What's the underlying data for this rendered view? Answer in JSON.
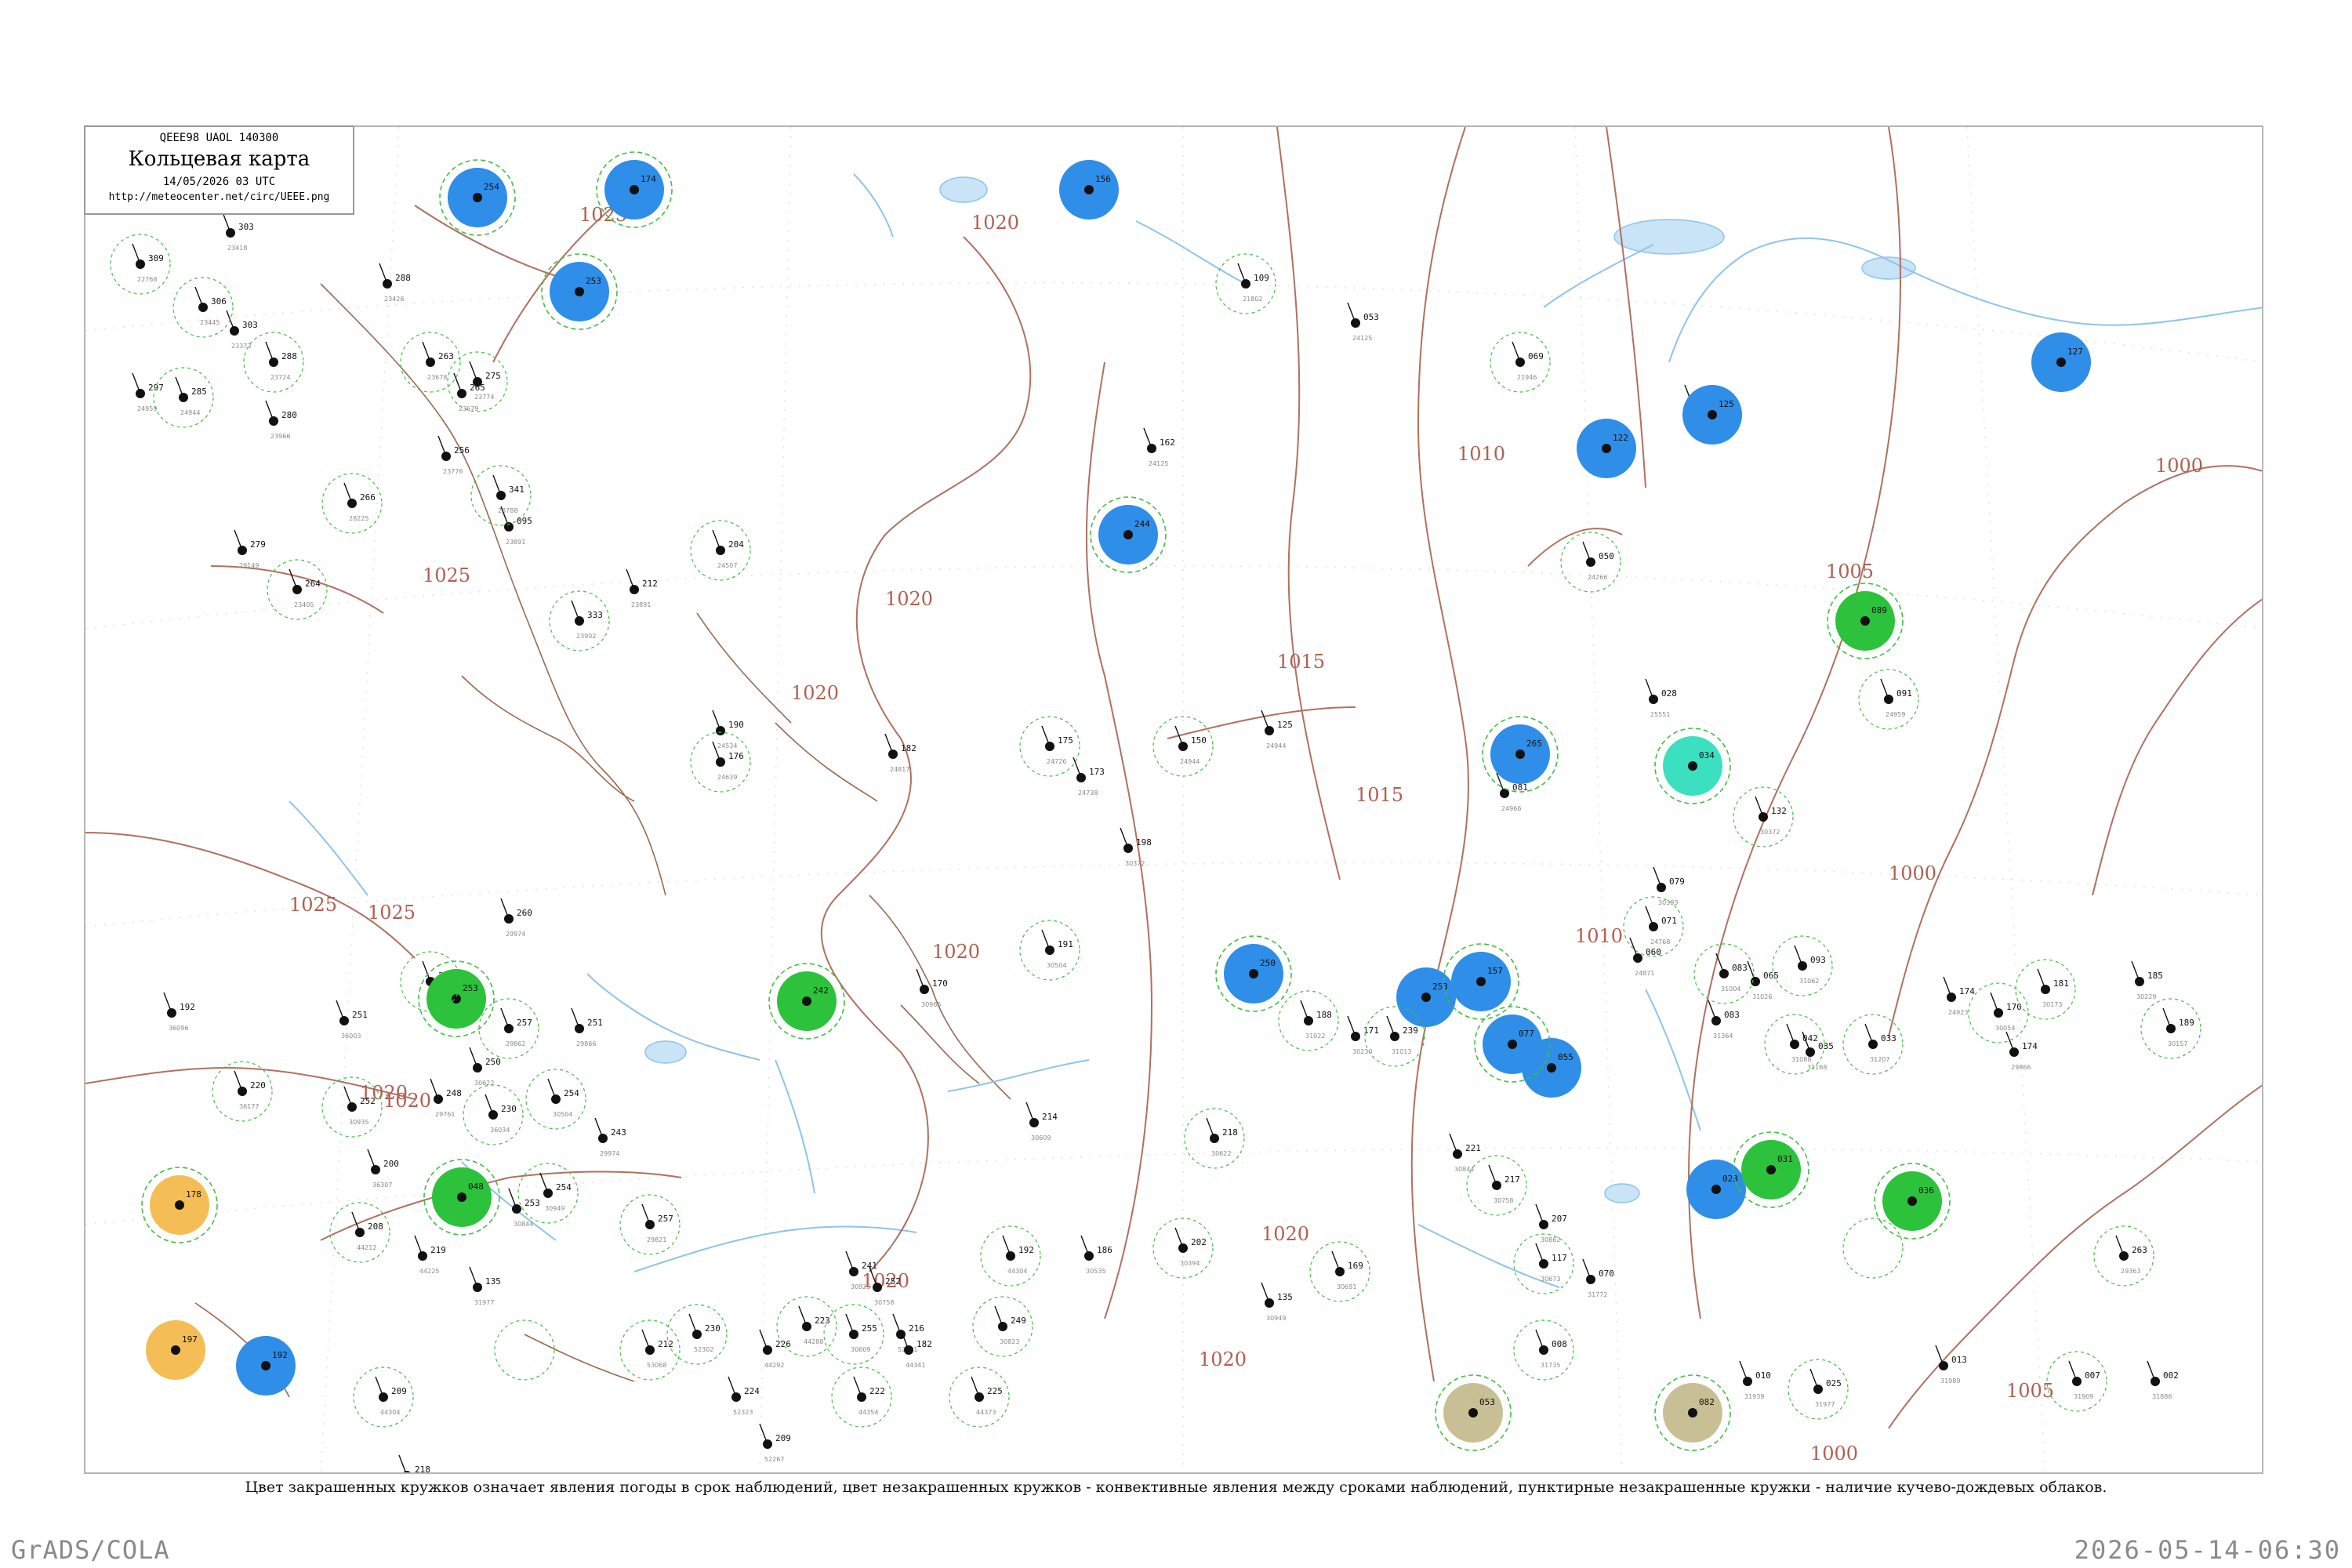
{
  "header": {
    "code_line": "QEEE98  UAOL  140300",
    "title": "Кольцевая карта",
    "date_line": "14/05/2026 03 UTC",
    "url": "http://meteocenter.net/circ/UEEE.png"
  },
  "legend_caption": "Цвет закрашенных кружков означает явления погоды в срок наблюдений, цвет незакрашенных кружков - конвективные явления между сроками наблюдений, пунктирные незакрашенные кружки - наличие кучево-дождевых облаков.",
  "footer": {
    "left": "GrADS/COLA",
    "right": "2026-05-14-06:30"
  },
  "colors": {
    "rain": "#2f8ee8",
    "thunder": "#2cc23c",
    "shower_cyan": "#3ae0c0",
    "haze_orange": "#f5bd55",
    "dust_olive": "#c8c094",
    "cb_ring": "#3fbf3f",
    "isobar": "#b07060",
    "river": "#8ec4ec"
  },
  "isobar_labels": [
    "1025",
    "1020",
    "1020",
    "1020",
    "1025",
    "1025",
    "1020",
    "1020",
    "1015",
    "1010",
    "1010",
    "1005",
    "1000",
    "1000",
    "1005",
    "1000",
    "1020",
    "1020",
    "1020",
    "1025",
    "1020",
    "1015"
  ],
  "station_circles": [
    {
      "type": "rain",
      "label": "254"
    },
    {
      "type": "rain",
      "label": "174"
    },
    {
      "type": "rain",
      "label": "156"
    },
    {
      "type": "rain",
      "label": "253"
    },
    {
      "type": "rain",
      "label": "244"
    },
    {
      "type": "rain",
      "label": "250"
    },
    {
      "type": "rain",
      "label": "265"
    },
    {
      "type": "rain",
      "label": "253"
    },
    {
      "type": "rain",
      "label": "157"
    },
    {
      "type": "rain",
      "label": "077"
    },
    {
      "type": "rain",
      "label": "055"
    },
    {
      "type": "rain",
      "label": "122"
    },
    {
      "type": "rain",
      "label": "125"
    },
    {
      "type": "rain",
      "label": "127"
    },
    {
      "type": "rain",
      "label": "023"
    },
    {
      "type": "rain",
      "label": "192"
    },
    {
      "type": "thunder",
      "label": "253"
    },
    {
      "type": "thunder",
      "label": "242"
    },
    {
      "type": "thunder",
      "label": "089"
    },
    {
      "type": "thunder",
      "label": "048"
    },
    {
      "type": "thunder",
      "label": "031"
    },
    {
      "type": "thunder",
      "label": "036"
    },
    {
      "type": "shower_cyan",
      "label": "034"
    },
    {
      "type": "haze_orange",
      "label": "178"
    },
    {
      "type": "haze_orange",
      "label": "197"
    },
    {
      "type": "dust_olive",
      "label": "053"
    },
    {
      "type": "dust_olive",
      "label": "082"
    }
  ],
  "stations": [
    {
      "num": "274",
      "name": "23511"
    },
    {
      "num": "303",
      "name": "23418"
    },
    {
      "num": "309",
      "name": "22768"
    },
    {
      "num": "288",
      "name": "23426"
    },
    {
      "num": "306",
      "name": "23445"
    },
    {
      "num": "303",
      "name": "23373"
    },
    {
      "num": "288",
      "name": "23724"
    },
    {
      "num": "297",
      "name": "24959"
    },
    {
      "num": "285",
      "name": "24944"
    },
    {
      "num": "280",
      "name": "23966"
    },
    {
      "num": "263",
      "name": "23678"
    },
    {
      "num": "265",
      "name": "23679"
    },
    {
      "num": "275",
      "name": "23774"
    },
    {
      "num": "256",
      "name": "23776"
    },
    {
      "num": "341",
      "name": "23788"
    },
    {
      "num": "095",
      "name": "23891"
    },
    {
      "num": "266",
      "name": "28225"
    },
    {
      "num": "279",
      "name": "29149"
    },
    {
      "num": "264",
      "name": "23405"
    },
    {
      "num": "212",
      "name": "23891"
    },
    {
      "num": "333",
      "name": "23902"
    },
    {
      "num": "190",
      "name": "24534"
    },
    {
      "num": "176",
      "name": "24639"
    },
    {
      "num": "182",
      "name": "24817"
    },
    {
      "num": "175",
      "name": "24726"
    },
    {
      "num": "173",
      "name": "24738"
    },
    {
      "num": "150",
      "name": "24944"
    },
    {
      "num": "125",
      "name": "24944"
    },
    {
      "num": "204",
      "name": "24507"
    },
    {
      "num": "162",
      "name": "24125"
    },
    {
      "num": "109",
      "name": "21802"
    },
    {
      "num": "053",
      "name": "24125"
    },
    {
      "num": "069",
      "name": "21946"
    },
    {
      "num": "055",
      "name": "21921"
    },
    {
      "num": "050",
      "name": "24266"
    },
    {
      "num": "028",
      "name": "25551"
    },
    {
      "num": "091",
      "name": "24959"
    },
    {
      "num": "081",
      "name": "24966"
    },
    {
      "num": "132",
      "name": "30372"
    },
    {
      "num": "079",
      "name": "30393"
    },
    {
      "num": "071",
      "name": "24768"
    },
    {
      "num": "060",
      "name": "24871"
    },
    {
      "num": "083",
      "name": "31004"
    },
    {
      "num": "065",
      "name": "31026"
    },
    {
      "num": "093",
      "name": "31062"
    },
    {
      "num": "083",
      "name": "31364"
    },
    {
      "num": "042",
      "name": "31088"
    },
    {
      "num": "035",
      "name": "31168"
    },
    {
      "num": "033",
      "name": "31207"
    },
    {
      "num": "174",
      "name": "24923"
    },
    {
      "num": "170",
      "name": "30054"
    },
    {
      "num": "174",
      "name": "29866"
    },
    {
      "num": "181",
      "name": "30173"
    },
    {
      "num": "185",
      "name": "30229"
    },
    {
      "num": "189",
      "name": "30157"
    },
    {
      "num": "198",
      "name": "30372"
    },
    {
      "num": "191",
      "name": "30504"
    },
    {
      "num": "170",
      "name": "30965"
    },
    {
      "num": "188",
      "name": "31022"
    },
    {
      "num": "171",
      "name": "30230"
    },
    {
      "num": "239",
      "name": "31013"
    },
    {
      "num": "214",
      "name": "30609"
    },
    {
      "num": "218",
      "name": "30622"
    },
    {
      "num": "221",
      "name": "30844"
    },
    {
      "num": "217",
      "name": "30758"
    },
    {
      "num": "207",
      "name": "30862"
    },
    {
      "num": "202",
      "name": "30394"
    },
    {
      "num": "186",
      "name": "30535"
    },
    {
      "num": "169",
      "name": "30691"
    },
    {
      "num": "135",
      "name": "30949"
    },
    {
      "num": "117",
      "name": "30673"
    },
    {
      "num": "070",
      "name": "31772"
    },
    {
      "num": "008",
      "name": "31735"
    },
    {
      "num": "010",
      "name": "31939"
    },
    {
      "num": "025",
      "name": "31977"
    },
    {
      "num": "013",
      "name": "31989"
    },
    {
      "num": "007",
      "name": "31909"
    },
    {
      "num": "002",
      "name": "31886"
    },
    {
      "num": "263",
      "name": "29363"
    },
    {
      "num": "260",
      "name": "29974"
    },
    {
      "num": "262",
      "name": "30635"
    },
    {
      "num": "251",
      "name": "29866"
    },
    {
      "num": "257",
      "name": "29862"
    },
    {
      "num": "248",
      "name": "29761"
    },
    {
      "num": "230",
      "name": "36034"
    },
    {
      "num": "192",
      "name": "36096"
    },
    {
      "num": "220",
      "name": "36177"
    },
    {
      "num": "200",
      "name": "36307"
    },
    {
      "num": "208",
      "name": "44212"
    },
    {
      "num": "219",
      "name": "44225"
    },
    {
      "num": "209",
      "name": "44304"
    },
    {
      "num": "218",
      "name": "44241"
    },
    {
      "num": "212",
      "name": "53068"
    },
    {
      "num": "209",
      "name": "52267"
    },
    {
      "num": "222",
      "name": "44354"
    },
    {
      "num": "224",
      "name": "52323"
    },
    {
      "num": "230",
      "name": "52302"
    },
    {
      "num": "226",
      "name": "44292"
    },
    {
      "num": "223",
      "name": "44288"
    },
    {
      "num": "216",
      "name": "52681"
    },
    {
      "num": "225",
      "name": "44373"
    },
    {
      "num": "182",
      "name": "44341"
    },
    {
      "num": "192",
      "name": "44304"
    },
    {
      "num": "241",
      "name": "30925"
    },
    {
      "num": "249",
      "name": "30823"
    },
    {
      "num": "250",
      "name": "30622"
    },
    {
      "num": "254",
      "name": "30504"
    },
    {
      "num": "243",
      "name": "29974"
    },
    {
      "num": "254",
      "name": "30949"
    },
    {
      "num": "251",
      "name": "36003"
    },
    {
      "num": "252",
      "name": "30935"
    },
    {
      "num": "253",
      "name": "30844"
    },
    {
      "num": "257",
      "name": "29821"
    },
    {
      "num": "252",
      "name": "30758"
    },
    {
      "num": "255",
      "name": "30609"
    },
    {
      "num": "135",
      "name": "31977"
    }
  ]
}
